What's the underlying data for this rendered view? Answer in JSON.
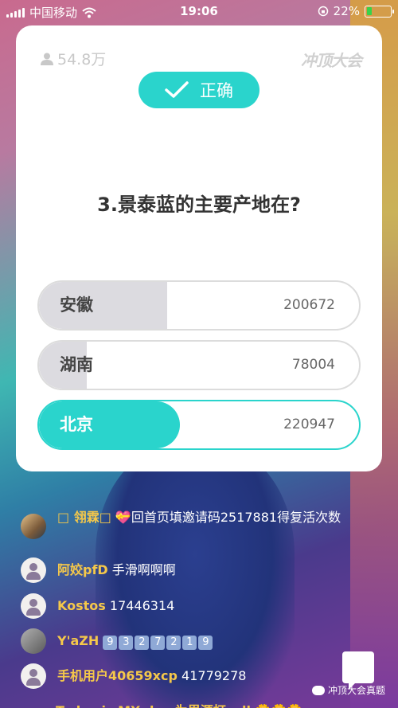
{
  "status_bar": {
    "carrier": "中国移动",
    "time": "19:06",
    "battery": "22%"
  },
  "card": {
    "viewers": "54.8万",
    "brand": "冲顶大会",
    "result_label": "正确",
    "question": "3.景泰蓝的主要产地在?",
    "options": [
      {
        "label": "安徽",
        "count": "200672",
        "fraction": 0.4,
        "correct": false
      },
      {
        "label": "湖南",
        "count": "78004",
        "fraction": 0.15,
        "correct": false
      },
      {
        "label": "北京",
        "count": "220947",
        "fraction": 0.44,
        "correct": true
      }
    ]
  },
  "comments": [
    {
      "name": "□ 翎霖□",
      "text": "💝回首页填邀请码2517881得复活次数"
    },
    {
      "name": "阿姣pfD",
      "text": "手滑啊啊啊"
    },
    {
      "name": "Kostos",
      "text": "17446314"
    },
    {
      "name": "Y'aZH",
      "digits": [
        "9",
        "3",
        "2",
        "7",
        "2",
        "1",
        "9"
      ]
    },
    {
      "name": "手机用户40659xcp",
      "text": "41779278"
    }
  ],
  "partial_comment": "Today is MX day 为里源打call 🌼🌼🌼",
  "watermark": "冲顶大会真题"
}
